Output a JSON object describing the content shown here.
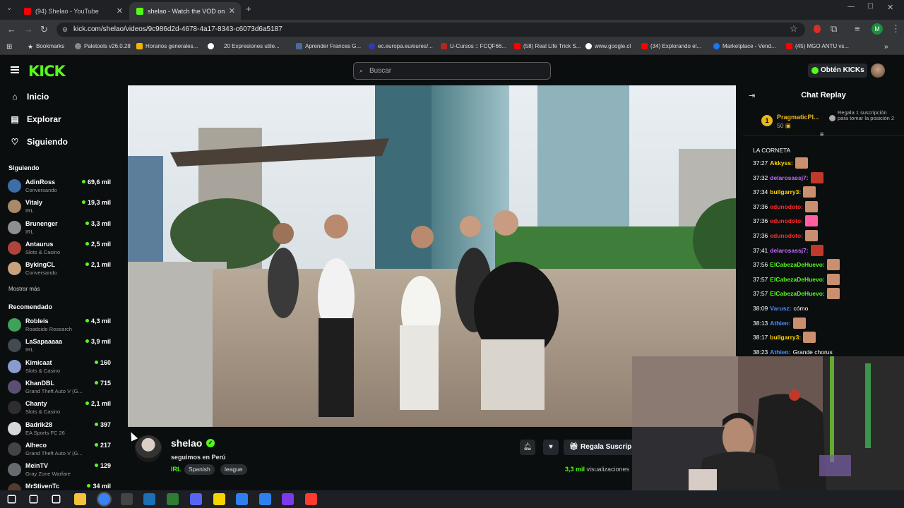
{
  "browser": {
    "tabs": [
      {
        "title": "(94) Shelao - YouTube",
        "active": false
      },
      {
        "title": "shelao - Watch the VOD on",
        "active": true
      }
    ],
    "new_tab": "+",
    "url": "kick.com/shelao/videos/9c986d2d-4678-4a17-8343-c6073d6a5187",
    "bookmarks": [
      "Bookmarks",
      "Paletools v26.0.28",
      "Horarios generales...",
      "20 Expresiones utile...",
      "Aprender Frances G...",
      "ec.europa.eu/eures/...",
      "U-Cursos :: FCQF66...",
      "(58) Real Life Trick S...",
      "www.google.cl",
      "(34) Explorando el...",
      "Marketplace - Vend...",
      "(45) MGO ANTU vs..."
    ],
    "profile_initial": "M"
  },
  "header": {
    "logo": "KICK",
    "search_placeholder": "Buscar",
    "kicks_button": "Obtén KICKs"
  },
  "sidebar": {
    "nav": [
      {
        "label": "Inicio",
        "icon": "home-icon"
      },
      {
        "label": "Explorar",
        "icon": "explore-icon"
      },
      {
        "label": "Siguiendo",
        "icon": "heart-icon"
      }
    ],
    "following_title": "Siguiendo",
    "following": [
      {
        "name": "AdinRoss",
        "category": "Conversando",
        "viewers": "69,6 mil",
        "color": "#3d6ea8"
      },
      {
        "name": "Vitaly",
        "category": "IRL",
        "viewers": "19,3 mil",
        "color": "#a8896a"
      },
      {
        "name": "Brunenger",
        "category": "IRL",
        "viewers": "3,3 mil",
        "color": "#8f8f8f"
      },
      {
        "name": "Antaurus",
        "category": "Slots & Casino",
        "viewers": "2,5 mil",
        "color": "#b0443a"
      },
      {
        "name": "BykingCL",
        "category": "Conversando",
        "viewers": "2,1 mil",
        "color": "#c9a27b"
      }
    ],
    "show_more": "Mostrar más",
    "recommended_title": "Recomendado",
    "recommended": [
      {
        "name": "Robleis",
        "category": "Roadside Research",
        "viewers": "4,3 mil",
        "color": "#3fa25a"
      },
      {
        "name": "LaSapaaaaa",
        "category": "IRL",
        "viewers": "3,9 mil",
        "color": "#444a52"
      },
      {
        "name": "Kimicaat",
        "category": "Slots & Casino",
        "viewers": "160",
        "color": "#8a9ccf"
      },
      {
        "name": "KhanDBL",
        "category": "Grand Theft Auto V (G...",
        "viewers": "715",
        "color": "#5a4f73"
      },
      {
        "name": "Chanty",
        "category": "Slots & Casino",
        "viewers": "2,1 mil",
        "color": "#2e2e2e"
      },
      {
        "name": "Badrik28",
        "category": "EA Sports FC 26",
        "viewers": "397",
        "color": "#d7d7d7"
      },
      {
        "name": "Alheco",
        "category": "Grand Theft Auto V (G...",
        "viewers": "217",
        "color": "#444"
      },
      {
        "name": "MeinTV",
        "category": "Gray Zone Warfare",
        "viewers": "129",
        "color": "#666b70"
      },
      {
        "name": "MrStivenTc",
        "category": "",
        "viewers": "34 mil",
        "color": "#553a30"
      }
    ]
  },
  "channel": {
    "name": "shelao",
    "title": "seguimos en Perú",
    "category": "IRL",
    "tags": [
      "Spanish",
      "league"
    ],
    "subscribe_label": "Regala Suscrip",
    "views_count": "3,3 mil",
    "views_label": "visualizaciones"
  },
  "chat": {
    "title": "Chat Replay",
    "pinned": {
      "rank": "1",
      "user": "PragmaticPl...",
      "count": "50",
      "message": "Regala 1 suscripción para tomar la posición 2"
    },
    "group_label": "LA CORNETA",
    "messages": [
      {
        "time": "37:27",
        "user": "Akkyss:",
        "color": "#ffd400",
        "text": "",
        "emote": "#c98f6e"
      },
      {
        "time": "37:32",
        "user": "delarosassj7:",
        "color": "#c36cff",
        "text": "",
        "emote": "#c0392b"
      },
      {
        "time": "37:34",
        "user": "bullgarry3:",
        "color": "#ffd400",
        "text": "",
        "emote": "#c98f6e"
      },
      {
        "time": "37:36",
        "user": "edunodoto:",
        "color": "#ff2d2d",
        "text": "",
        "emote": "#c98f6e"
      },
      {
        "time": "37:36",
        "user": "edunodoto:",
        "color": "#ff2d2d",
        "text": "",
        "emote": "#ff5fa2"
      },
      {
        "time": "37:36",
        "user": "edunodoto:",
        "color": "#ff2d2d",
        "text": "",
        "emote": "#c98f6e"
      },
      {
        "time": "37:41",
        "user": "delarosassj7:",
        "color": "#c36cff",
        "text": "",
        "emote": "#c0392b"
      },
      {
        "time": "37:56",
        "user": "ElCabezaDeHuevo:",
        "color": "#53fc18",
        "text": "",
        "emote": "#c98f6e"
      },
      {
        "time": "37:57",
        "user": "ElCabezaDeHuevo:",
        "color": "#53fc18",
        "text": "",
        "emote": "#c98f6e"
      },
      {
        "time": "37:57",
        "user": "ElCabezaDeHuevo:",
        "color": "#53fc18",
        "text": "",
        "emote": "#c98f6e"
      },
      {
        "time": "38:09",
        "user": "Varusz:",
        "color": "#4a8dff",
        "text": "cómo",
        "emote": ""
      },
      {
        "time": "38:13",
        "user": "Athien:",
        "color": "#4a8dff",
        "text": "",
        "emote": "#c98f6e"
      },
      {
        "time": "38:17",
        "user": "bullgarry3:",
        "color": "#ffd400",
        "text": "",
        "emote": "#c98f6e"
      },
      {
        "time": "38:23",
        "user": "Athien:",
        "color": "#4a8dff",
        "text": "Grande chorus",
        "emote": ""
      }
    ]
  },
  "taskbar": {
    "apps": [
      "windows-start-icon",
      "search-icon",
      "task-view-icon",
      "file-explorer-icon",
      "chrome-icon",
      "obs-icon",
      "steam-icon",
      "app-icon",
      "discord-icon",
      "notes-icon",
      "calendar-icon",
      "calculator-icon",
      "game-icon",
      "ea-icon"
    ],
    "colors": [
      "#ffffff",
      "#ffffff",
      "#ffffff",
      "#f3c33d",
      "#3b82f6",
      "#444444",
      "#1b6fb3",
      "#2e7d32",
      "#5865f2",
      "#f5d400",
      "#2f80ed",
      "#2f80ed",
      "#7c3aed",
      "#ff3b30"
    ]
  }
}
